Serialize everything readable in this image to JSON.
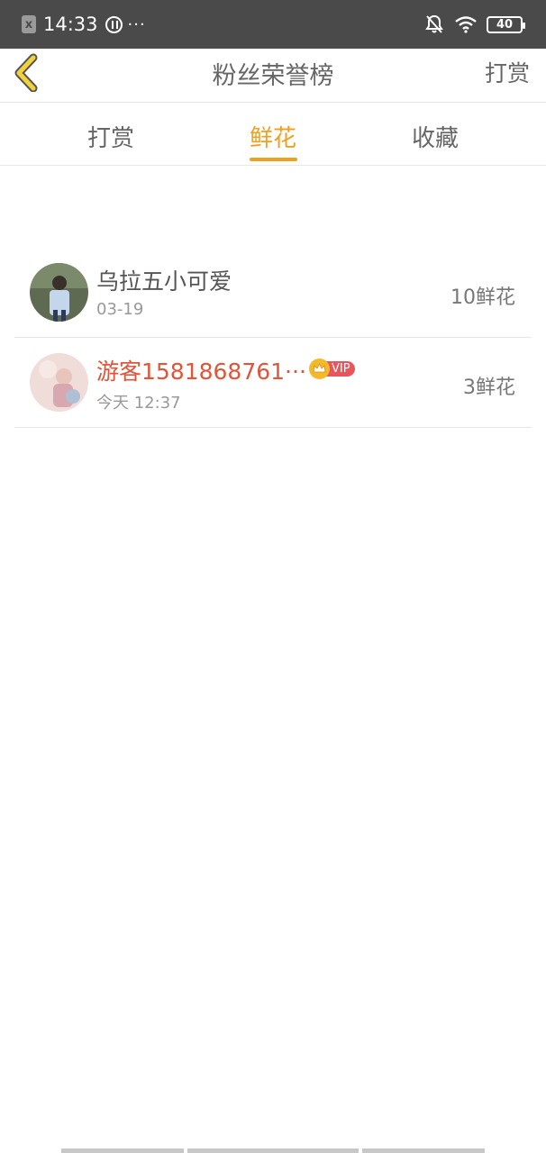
{
  "status_bar": {
    "time": "14:33",
    "dots": "···",
    "battery": "40",
    "notification_glyph": "x"
  },
  "header": {
    "title": "粉丝荣誉榜",
    "right_action": "打赏"
  },
  "tabs": [
    {
      "label": "打赏",
      "active": false
    },
    {
      "label": "鲜花",
      "active": true
    },
    {
      "label": "收藏",
      "active": false
    }
  ],
  "list": [
    {
      "name": "乌拉五小可爱",
      "date": "03-19",
      "count": "10鲜花",
      "vip": false
    },
    {
      "name": "游客1581868761···",
      "date": "今天 12:37",
      "count": "3鲜花",
      "vip": true,
      "badge": "VIP"
    }
  ],
  "colors": {
    "accent": "#f0a020",
    "vip_name": "#e0553a",
    "vip_tag": "#e8555c",
    "status_bar_bg": "#4a4a4a"
  }
}
